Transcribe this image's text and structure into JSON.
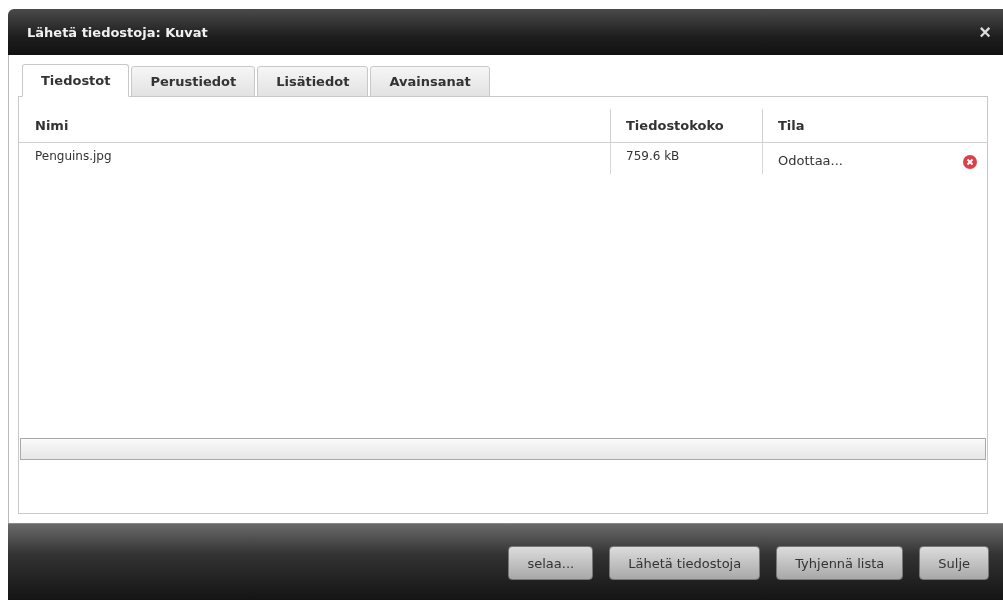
{
  "window": {
    "title": "Lähetä tiedostoja: Kuvat",
    "close": "×"
  },
  "tabs": [
    {
      "label": "Tiedostot",
      "selected": true
    },
    {
      "label": "Perustiedot",
      "selected": false
    },
    {
      "label": "Lisätiedot",
      "selected": false
    },
    {
      "label": "Avainsanat",
      "selected": false
    }
  ],
  "table": {
    "columns": [
      "Nimi",
      "Tiedostokoko",
      "Tila"
    ],
    "rows": [
      {
        "name": "Penguins.jpg",
        "size": "759.6 kB",
        "status": "Odottaa..."
      }
    ]
  },
  "progress": {
    "level": 0
  },
  "buttons": [
    "selaa...",
    "Lähetä tiedostoja",
    "Tyhjennä lista",
    "Sulje"
  ]
}
